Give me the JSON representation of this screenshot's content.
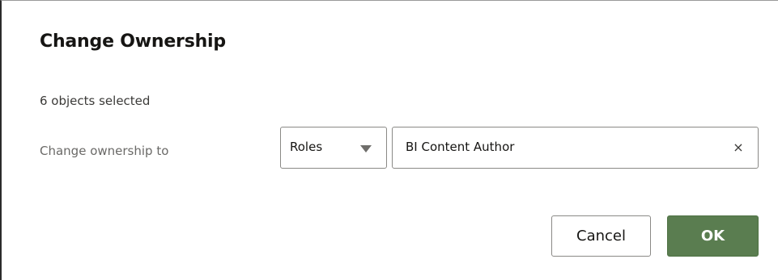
{
  "dialog": {
    "title": "Change Ownership",
    "selection_count": "6 objects selected",
    "field_label": "Change ownership to",
    "type_select": {
      "value": "Roles",
      "arrow_icon": "chevron-down-icon"
    },
    "owner_input": {
      "value": "BI Content Author",
      "clear_icon": "×"
    },
    "buttons": {
      "cancel_label": "Cancel",
      "ok_label": "OK"
    }
  },
  "colors": {
    "ok_button": "#5a7d50",
    "border": "#8a8986",
    "text": "#161513",
    "label": "#6a6967"
  }
}
